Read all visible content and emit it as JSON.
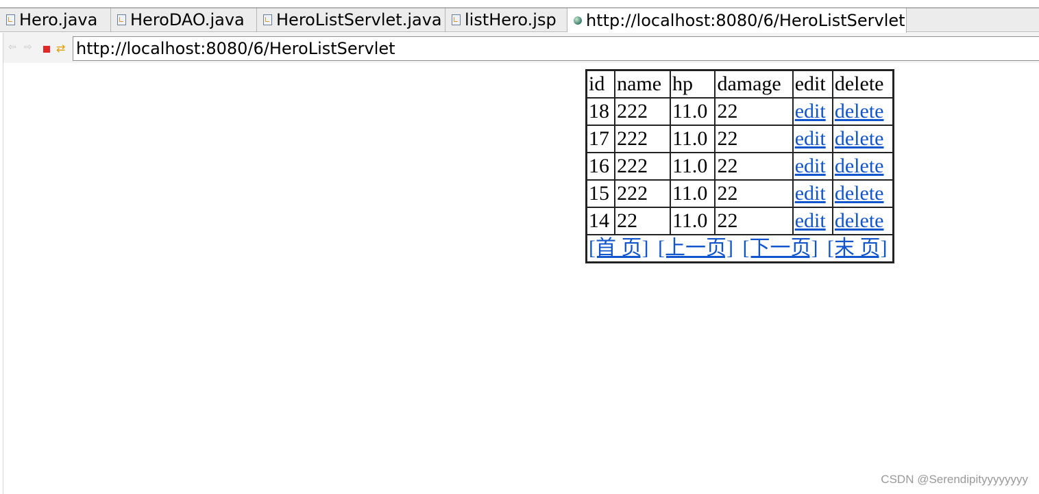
{
  "tabs": [
    {
      "label": "Hero.java",
      "icon": "java-file-icon"
    },
    {
      "label": "HeroDAO.java",
      "icon": "java-file-icon"
    },
    {
      "label": "HeroListServlet.java",
      "icon": "java-file-icon"
    },
    {
      "label": "listHero.jsp",
      "icon": "jsp-file-icon"
    },
    {
      "label": "http://localhost:8080/6/HeroListServlet",
      "icon": "globe-icon",
      "close_glyph": "✕"
    }
  ],
  "navbar": {
    "back_glyph": "⇦",
    "forward_glyph": "⇨",
    "go_glyph": "⇄",
    "url": "http://localhost:8080/6/HeroListServlet"
  },
  "table": {
    "headers": [
      "id",
      "name",
      "hp",
      "damage",
      "edit",
      "delete"
    ],
    "rows": [
      {
        "id": "18",
        "name": "222",
        "hp": "11.0",
        "damage": "22",
        "edit": "edit",
        "delete": "delete"
      },
      {
        "id": "17",
        "name": "222",
        "hp": "11.0",
        "damage": "22",
        "edit": "edit",
        "delete": "delete"
      },
      {
        "id": "16",
        "name": "222",
        "hp": "11.0",
        "damage": "22",
        "edit": "edit",
        "delete": "delete"
      },
      {
        "id": "15",
        "name": "222",
        "hp": "11.0",
        "damage": "22",
        "edit": "edit",
        "delete": "delete"
      },
      {
        "id": "14",
        "name": "22",
        "hp": "11.0",
        "damage": "22",
        "edit": "edit",
        "delete": "delete"
      }
    ],
    "pager": {
      "first": "[首 页]",
      "prev": "[上一页]",
      "next": "[下一页]",
      "last": "[末 页]"
    }
  },
  "watermark": "CSDN @Serendipityyyyyyyy",
  "colors": {
    "link": "#1155cc",
    "stop": "#e0282a",
    "go": "#e0a000"
  }
}
